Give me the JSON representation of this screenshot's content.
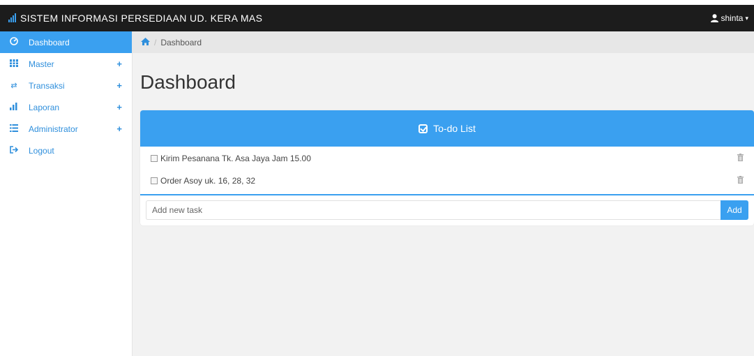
{
  "navbar": {
    "brand_icon": "signal-bars-icon",
    "brand": "SISTEM INFORMASI PERSEDIAAN UD. KERA MAS",
    "user": "shinta",
    "user_icon": "user-icon"
  },
  "sidebar": {
    "items": [
      {
        "label": "Dashboard",
        "icon": "dashboard-icon",
        "active": true
      },
      {
        "label": "Master",
        "icon": "grid-icon",
        "expandable": true
      },
      {
        "label": "Transaksi",
        "icon": "exchange-icon",
        "expandable": true
      },
      {
        "label": "Laporan",
        "icon": "bar-chart-icon",
        "expandable": true
      },
      {
        "label": "Administrator",
        "icon": "list-icon",
        "expandable": true
      },
      {
        "label": "Logout",
        "icon": "logout-icon"
      }
    ]
  },
  "breadcrumb": {
    "home_icon": "home-icon",
    "current": "Dashboard"
  },
  "page": {
    "title": "Dashboard"
  },
  "todo": {
    "header": "To-do List",
    "items": [
      {
        "text": "Kirim Pesanana Tk. Asa Jaya Jam 15.00",
        "checked": false
      },
      {
        "text": "Order Asoy uk. 16, 28, 32",
        "checked": false
      }
    ],
    "input_placeholder": "Add new task",
    "add_label": "Add"
  },
  "colors": {
    "accent": "#3aa0f0",
    "navbar": "#1c1c1c",
    "main_bg": "#f2f2f2"
  }
}
